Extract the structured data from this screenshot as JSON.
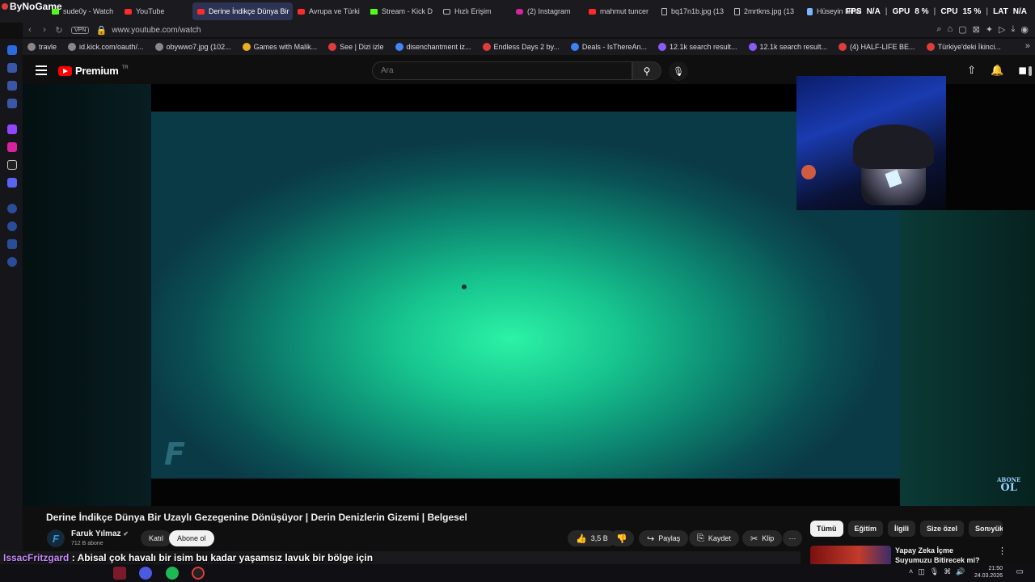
{
  "app": {
    "brand": "ByNoGame"
  },
  "tabs": [
    {
      "label": "sude0y - Watch",
      "icon": "kick"
    },
    {
      "label": "YouTube",
      "icon": "yt"
    },
    {
      "label": "Derine İndikçe Dünya Bir",
      "icon": "yt",
      "active": true
    },
    {
      "label": "Avrupa ve Türki",
      "icon": "yt"
    },
    {
      "label": "Stream - Kick D",
      "icon": "kick"
    },
    {
      "label": "Hızlı Erişim",
      "icon": "grid"
    },
    {
      "label": "(2) Instagram",
      "icon": "ig"
    },
    {
      "label": "mahmut tuncer",
      "icon": "yt"
    },
    {
      "label": "bq17n1b.jpg (13",
      "icon": "file"
    },
    {
      "label": "2mrtkns.jpg (13",
      "icon": "file"
    },
    {
      "label": "Hüseyin Nihal",
      "icon": "shield"
    }
  ],
  "hud": {
    "fps_label": "FPS",
    "fps_value": "N/A",
    "gpu_label": "GPU",
    "gpu_value": "8 %",
    "cpu_label": "CPU",
    "cpu_value": "15 %",
    "lat_label": "LAT",
    "lat_value": "N/A"
  },
  "address": {
    "vpn": "VPN",
    "url": "www.youtube.com/watch"
  },
  "bookmarks": [
    "travle",
    "id.kick.com/oauth/...",
    "obywwo7.jpg (102...",
    "Games with Malik...",
    "See | Dizi izle",
    "disenchantment iz...",
    "Endless Days 2 by...",
    "Deals - IsThereAn...",
    "12.1k search result...",
    "12.1k search result...",
    "(4) HALF-LIFE BE...",
    "Türkiye'deki İkinci..."
  ],
  "youtube": {
    "logo_text": "Premium",
    "region": "TR",
    "search_placeholder": "Ara",
    "video_title": "Derine İndikçe Dünya Bir Uzaylı Gezegenine Dönüşüyor | Derin Denizlerin Gizemi | Belgesel",
    "channel_name": "Faruk Yılmaz",
    "channel_initial": "F",
    "subscribers": "712 B abone",
    "join_label": "Katıl",
    "subscribe_label": "Abone ol",
    "likes": "3,5 B",
    "share_label": "Paylaş",
    "save_label": "Kaydet",
    "clip_label": "Klip",
    "overlay_logo": "F",
    "watermark_line1": "ABONE",
    "watermark_line2": "OL",
    "chips": [
      "Tümü",
      "Eğitim",
      "İlgili",
      "Size özel",
      "Son yükle"
    ],
    "recommendation_title": "Yapay Zeka İçme Suyumuzu Bitirecek mi?"
  },
  "chat": {
    "user": "IssacFritzgard",
    "separator": ":",
    "message": "Abisal çok havalı bir isim bu kadar yaşamsız lavuk bir bölge için kullanılmamalıydı ya"
  },
  "taskbar": {
    "time": "21:50",
    "date": "24.03.2026"
  }
}
